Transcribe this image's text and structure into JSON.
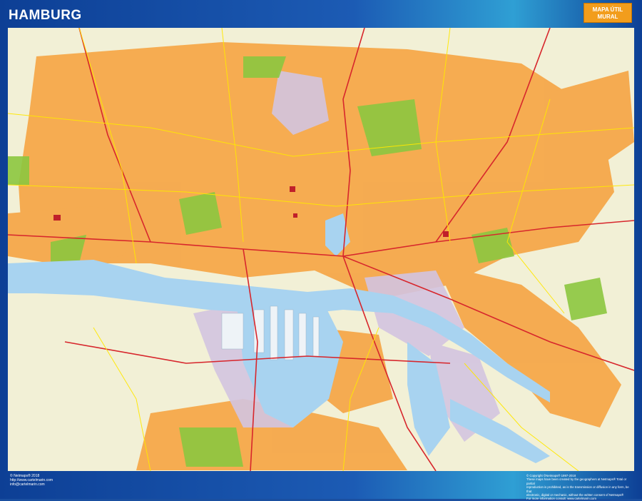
{
  "map": {
    "title": "HAMBURG",
    "badge_line1": "MAPA ÚTIL",
    "badge_line2": "MURAL",
    "colors": {
      "frame": "#1a4fa0",
      "urban": "#f6a84a",
      "background": "#f2f0d6",
      "water": "#a8d3f0",
      "park": "#8cc63f",
      "industrial": "#d3c4e0",
      "motorway": "#d7262c",
      "street": "#ffe800"
    }
  },
  "footer": {
    "left_line1": "© Netmaps® 2018",
    "left_line2": "http://www.cartelmarin.com",
    "left_line3": "info@cartelmarin.com",
    "right_line1": "© Copyright ©Netmaps® 1997-2018",
    "right_line2": "These maps have been created by the geographers at Netmaps® Total or partial",
    "right_line3": "reproduction is prohibited, as is the transmission or diffusion in any form, be that",
    "right_line4": "electronic, digital or mechanic, without the written consent of Netmaps®",
    "right_line5": "For more information consult: www.cartelmarin.com"
  }
}
